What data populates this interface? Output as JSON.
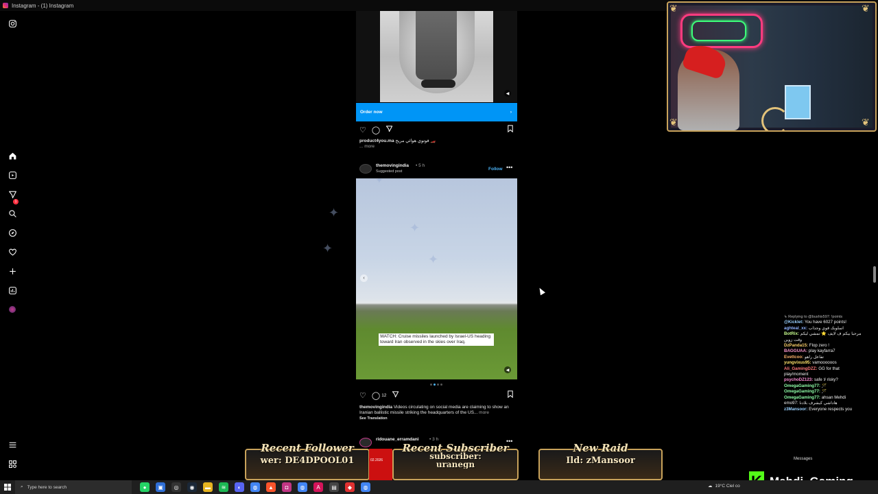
{
  "window": {
    "title": "Instagram - (1) Instagram"
  },
  "nav": {
    "icons": [
      "instagram-icon",
      "home-icon",
      "reels-icon",
      "messages-icon",
      "search-icon",
      "explore-icon",
      "notifications-icon",
      "create-icon",
      "dashboard-icon",
      "profile-icon",
      "menu-icon",
      "threads-icon"
    ],
    "messages_badge": "1"
  },
  "post1": {
    "cta": "Order now",
    "cta_arrow": "›",
    "caption_user": "product4you.ma",
    "caption_text": "فوتوي هوائي مريح 🏎️",
    "more": "... more"
  },
  "post2": {
    "username": "themovingindia",
    "time": "• 5 h",
    "suggested": "Suggested post",
    "follow": "Follow",
    "overlay": "WATCH: Cruise missiles launched by Israel-US heading toward Iran observed in the skies over Iraq.",
    "comment_count": "12",
    "caption_user": "themovingindia",
    "caption_text": "Videos circulating on social media are claiming to show an Iranian ballistic missile striking the headquarters of the US...",
    "more": "more",
    "see_translation": "See Translation"
  },
  "post3": {
    "username": "ridouane_erramdani",
    "time": "• 3 h"
  },
  "chat": [
    {
      "reply": "↳ Replying to @bushix597: !points"
    },
    {
      "user": "@Kicklet:",
      "text": " You have 6027 points!"
    },
    {
      "user": "aghteal_xx:",
      "text": " اسلوبك قوي وجذاب"
    },
    {
      "user": "BotRix:",
      "text": " مرحبا بيكم ف لايف ⭐ تمشي ليكم"
    },
    {
      "user": "",
      "text": "وقت زوين"
    },
    {
      "user": "DzPanda15:",
      "text": " Flop zero !"
    },
    {
      "user": "BAGGUAA:",
      "text": " play kayfarra7"
    },
    {
      "user": "Evettcoo:",
      "text": " تفاعل راهو"
    },
    {
      "user": "yungvixus95:",
      "text": " vamoooooos"
    },
    {
      "user": "Ali_GamingDZZ:",
      "text": " GG for that"
    },
    {
      "user": "",
      "text": "play/moment"
    },
    {
      "user": "psychoDZ123:",
      "text": " safe لا risky?"
    },
    {
      "user": "OmegaGaming77:",
      "text": " 🪄"
    },
    {
      "user": "OmegaGaming77:",
      "text": " 🪄"
    },
    {
      "user": "OmegaGaming77:",
      "text": " ahsan Mehdi"
    },
    {
      "user": "",
      "text": "emo97: هاداشي كيشرف بلادنا"
    },
    {
      "user": "z3Mansoor:",
      "text": " Everyone respects you"
    }
  ],
  "chat_messages_label": "Messages",
  "panels": {
    "follower": {
      "title": "Recent Follower",
      "value": "wer: DE4DPOOL01"
    },
    "subscriber": {
      "title": "Recent Subscriber",
      "value": "subscriber:",
      "value2": "uranegn"
    },
    "raid": {
      "title": "New Raid",
      "value": "Ild: zMansoor"
    },
    "red_strip_text": "02.2026"
  },
  "brand": {
    "logo": "K",
    "name": "Mehdi_Gaming"
  },
  "taskbar": {
    "search_placeholder": "Type here to search",
    "weather": "19°C  Ciel co"
  },
  "colors": {
    "accent_blue": "#0095f6",
    "follow_blue": "#4cb5f9",
    "kick_green": "#53fc18",
    "gold": "#c9a35b"
  }
}
